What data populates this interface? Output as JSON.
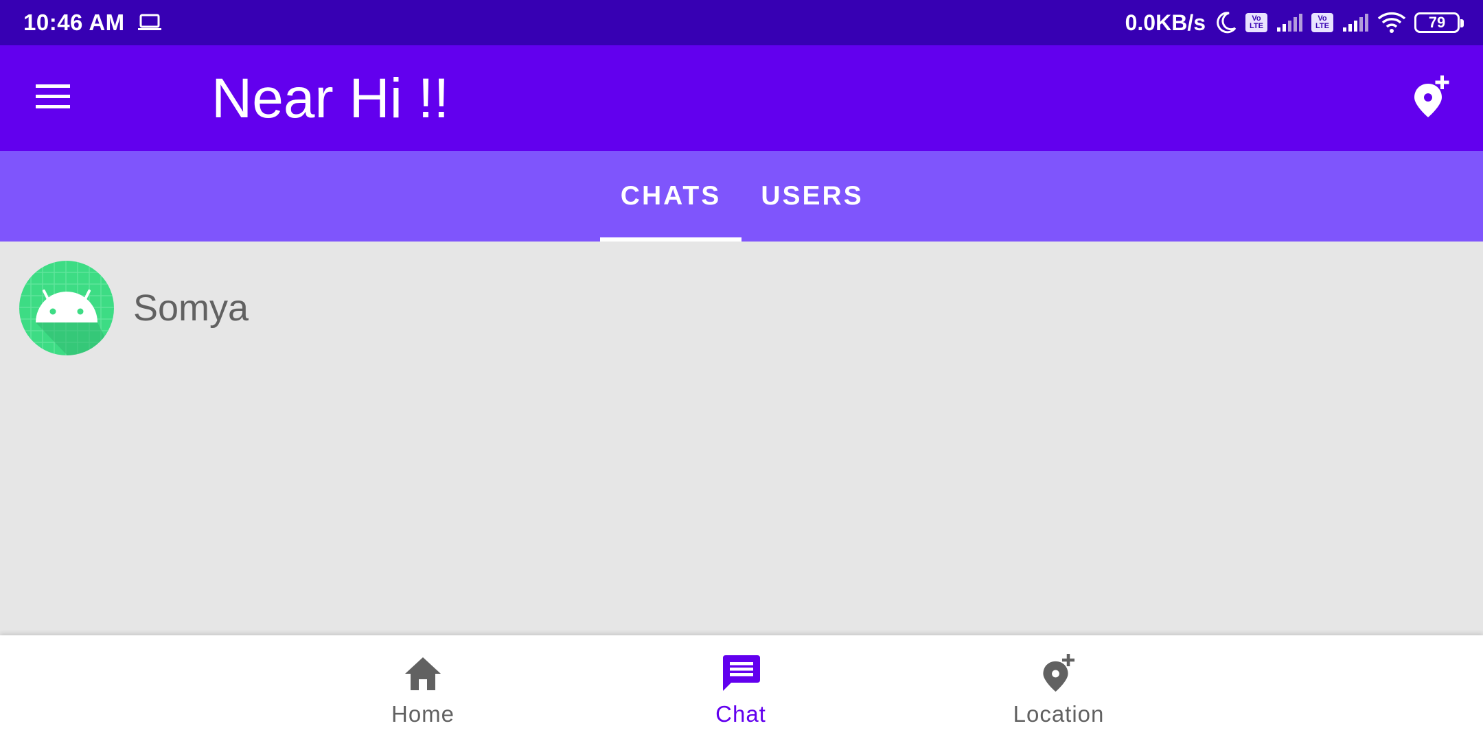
{
  "status_bar": {
    "time": "10:46 AM",
    "net_speed": "0.0KB/s",
    "battery": "79",
    "volte_top": "Vo",
    "volte_bottom": "LTE",
    "icons": [
      "laptop-icon",
      "moon-icon",
      "volte-icon",
      "signal-icon",
      "volte-icon",
      "signal-icon",
      "wifi-icon",
      "battery-icon"
    ]
  },
  "app_bar": {
    "title": "Near Hi !!",
    "menu_icon": "menu-icon",
    "action_icon": "add-location-icon"
  },
  "tabs": [
    {
      "label": "CHATS",
      "selected": true
    },
    {
      "label": "USERS",
      "selected": false
    }
  ],
  "chats": [
    {
      "name": "Somya",
      "avatar": "android-avatar"
    }
  ],
  "bottom_nav": [
    {
      "label": "Home",
      "icon": "home-icon",
      "selected": false
    },
    {
      "label": "Chat",
      "icon": "chat-icon",
      "selected": true
    },
    {
      "label": "Location",
      "icon": "add-location-icon",
      "selected": false
    }
  ],
  "colors": {
    "status_bar": "#3700b3",
    "primary": "#6200ee",
    "tab_bar": "#7f55fc",
    "background": "#e6e6e6",
    "nav_active": "#6200ee",
    "nav_inactive": "#616161",
    "avatar_green": "#3ddc84"
  }
}
